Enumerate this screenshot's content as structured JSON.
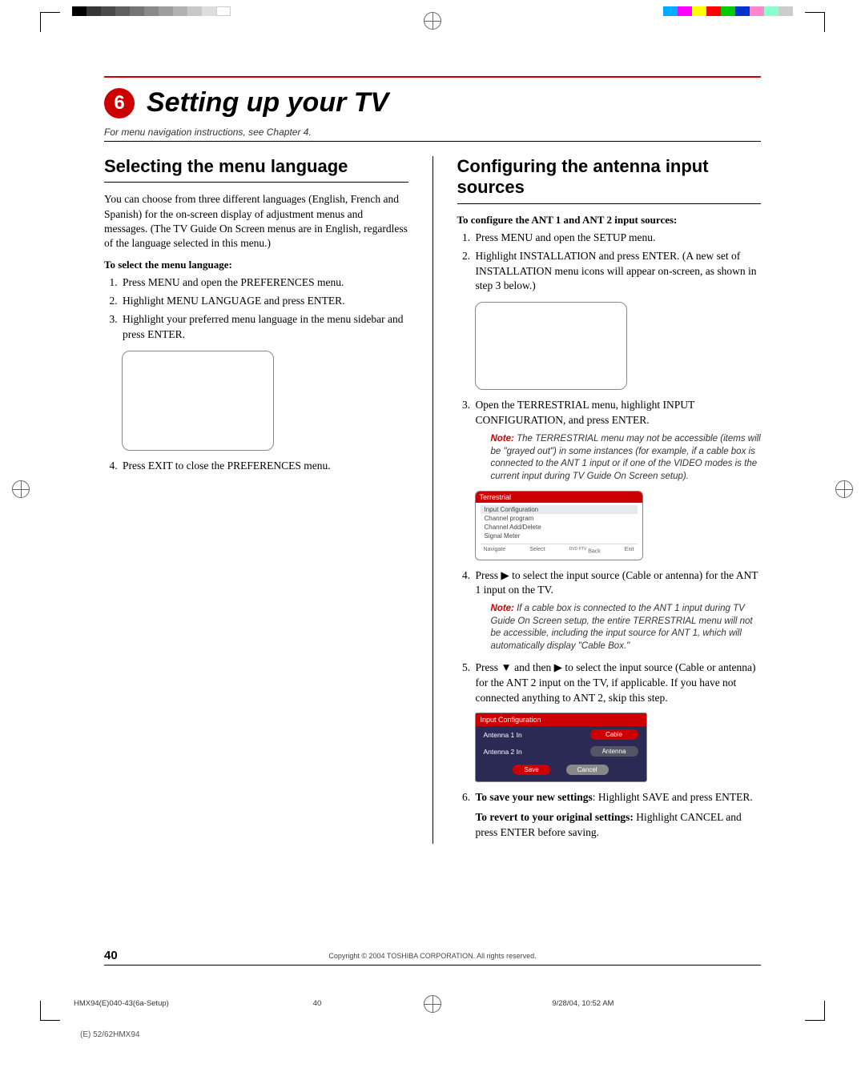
{
  "chapter": {
    "number": "6",
    "title": "Setting up your TV"
  },
  "intro_note": "For menu navigation instructions, see Chapter 4.",
  "left": {
    "heading": "Selecting the menu language",
    "para": "You can choose from three different languages (English, French and Spanish) for the on-screen display of adjustment menus and messages. (The TV Guide On Screen menus are in English, regardless of the language selected in this menu.)",
    "subhead": "To select the menu language:",
    "steps": [
      "Press MENU and open the PREFERENCES menu.",
      "Highlight MENU LANGUAGE and press ENTER.",
      "Highlight your preferred menu language in the menu sidebar and press ENTER."
    ],
    "step4": "Press EXIT to close the PREFERENCES menu."
  },
  "right": {
    "heading": "Configuring the antenna input sources",
    "subhead": "To configure the ANT 1 and ANT 2 input sources:",
    "step1": "Press MENU and open the SETUP menu.",
    "step2": "Highlight INSTALLATION and press ENTER. (A new set of INSTALLATION menu icons will appear on-screen, as shown in step 3 below.)",
    "step3": "Open the TERRESTRIAL menu, highlight INPUT CONFIGURATION, and press ENTER.",
    "note1_label": "Note:",
    "note1": " The TERRESTRIAL menu may not be accessible (items will be \"grayed out\") in some instances (for example, if a cable box is connected to the ANT 1 input or if one of the VIDEO modes is the current input during TV Guide On Screen setup).",
    "osd1": {
      "title": "Terrestrial",
      "items": [
        "Input Configuration",
        "Channel program",
        "Channel Add/Delete",
        "Signal Meter"
      ],
      "footer": [
        "Navigate",
        "Select",
        "Back",
        "Exit"
      ],
      "footer_key": "DVD PTV"
    },
    "step4_pre": "Press ",
    "step4_post": " to select the input source (Cable or antenna) for the ANT 1 input on the TV.",
    "note2_label": "Note:",
    "note2": " If a cable box is connected to the ANT 1 input during TV Guide On Screen setup, the entire TERRESTRIAL menu will not be accessible, including the input source for ANT 1, which will automatically display \"Cable Box.\"",
    "step5_pre": "Press ",
    "step5_mid": " and then ",
    "step5_post": " to select the input source (Cable or antenna) for the ANT 2 input on the TV, if applicable. If you have not connected anything to ANT 2, skip this step.",
    "osd2": {
      "title": "Input Configuration",
      "rows": [
        {
          "label": "Antenna 1 In",
          "value": "Cable"
        },
        {
          "label": "Antenna 2 In",
          "value": "Antenna"
        }
      ],
      "buttons": [
        "Save",
        "Cancel"
      ]
    },
    "step6_strong": "To save your new settings",
    "step6_rest": ": Highlight SAVE and press ENTER.",
    "step6b_strong": "To revert to your original settings:",
    "step6b_rest": " Highlight CANCEL and press ENTER before saving."
  },
  "footer": {
    "page_num": "40",
    "copyright": "Copyright © 2004 TOSHIBA CORPORATION. All rights reserved."
  },
  "imprint": {
    "filename": "HMX94(E)040-43(6a-Setup)",
    "page": "40",
    "timestamp": "9/28/04, 10:52 AM",
    "stray": "(E) 52/62HMX94"
  },
  "colorbar_left": [
    "#000",
    "#353535",
    "#4a4a4a",
    "#5f5f5f",
    "#747474",
    "#898989",
    "#9e9e9e",
    "#b3b3b3",
    "#c8c8c8",
    "#ddd",
    "#fff"
  ],
  "colorbar_right": [
    "#00aaff",
    "#ff00ff",
    "#ffff00",
    "#ff0000",
    "#00cc00",
    "#0033cc",
    "#ff88cc",
    "#88ffcc",
    "#cccccc"
  ]
}
